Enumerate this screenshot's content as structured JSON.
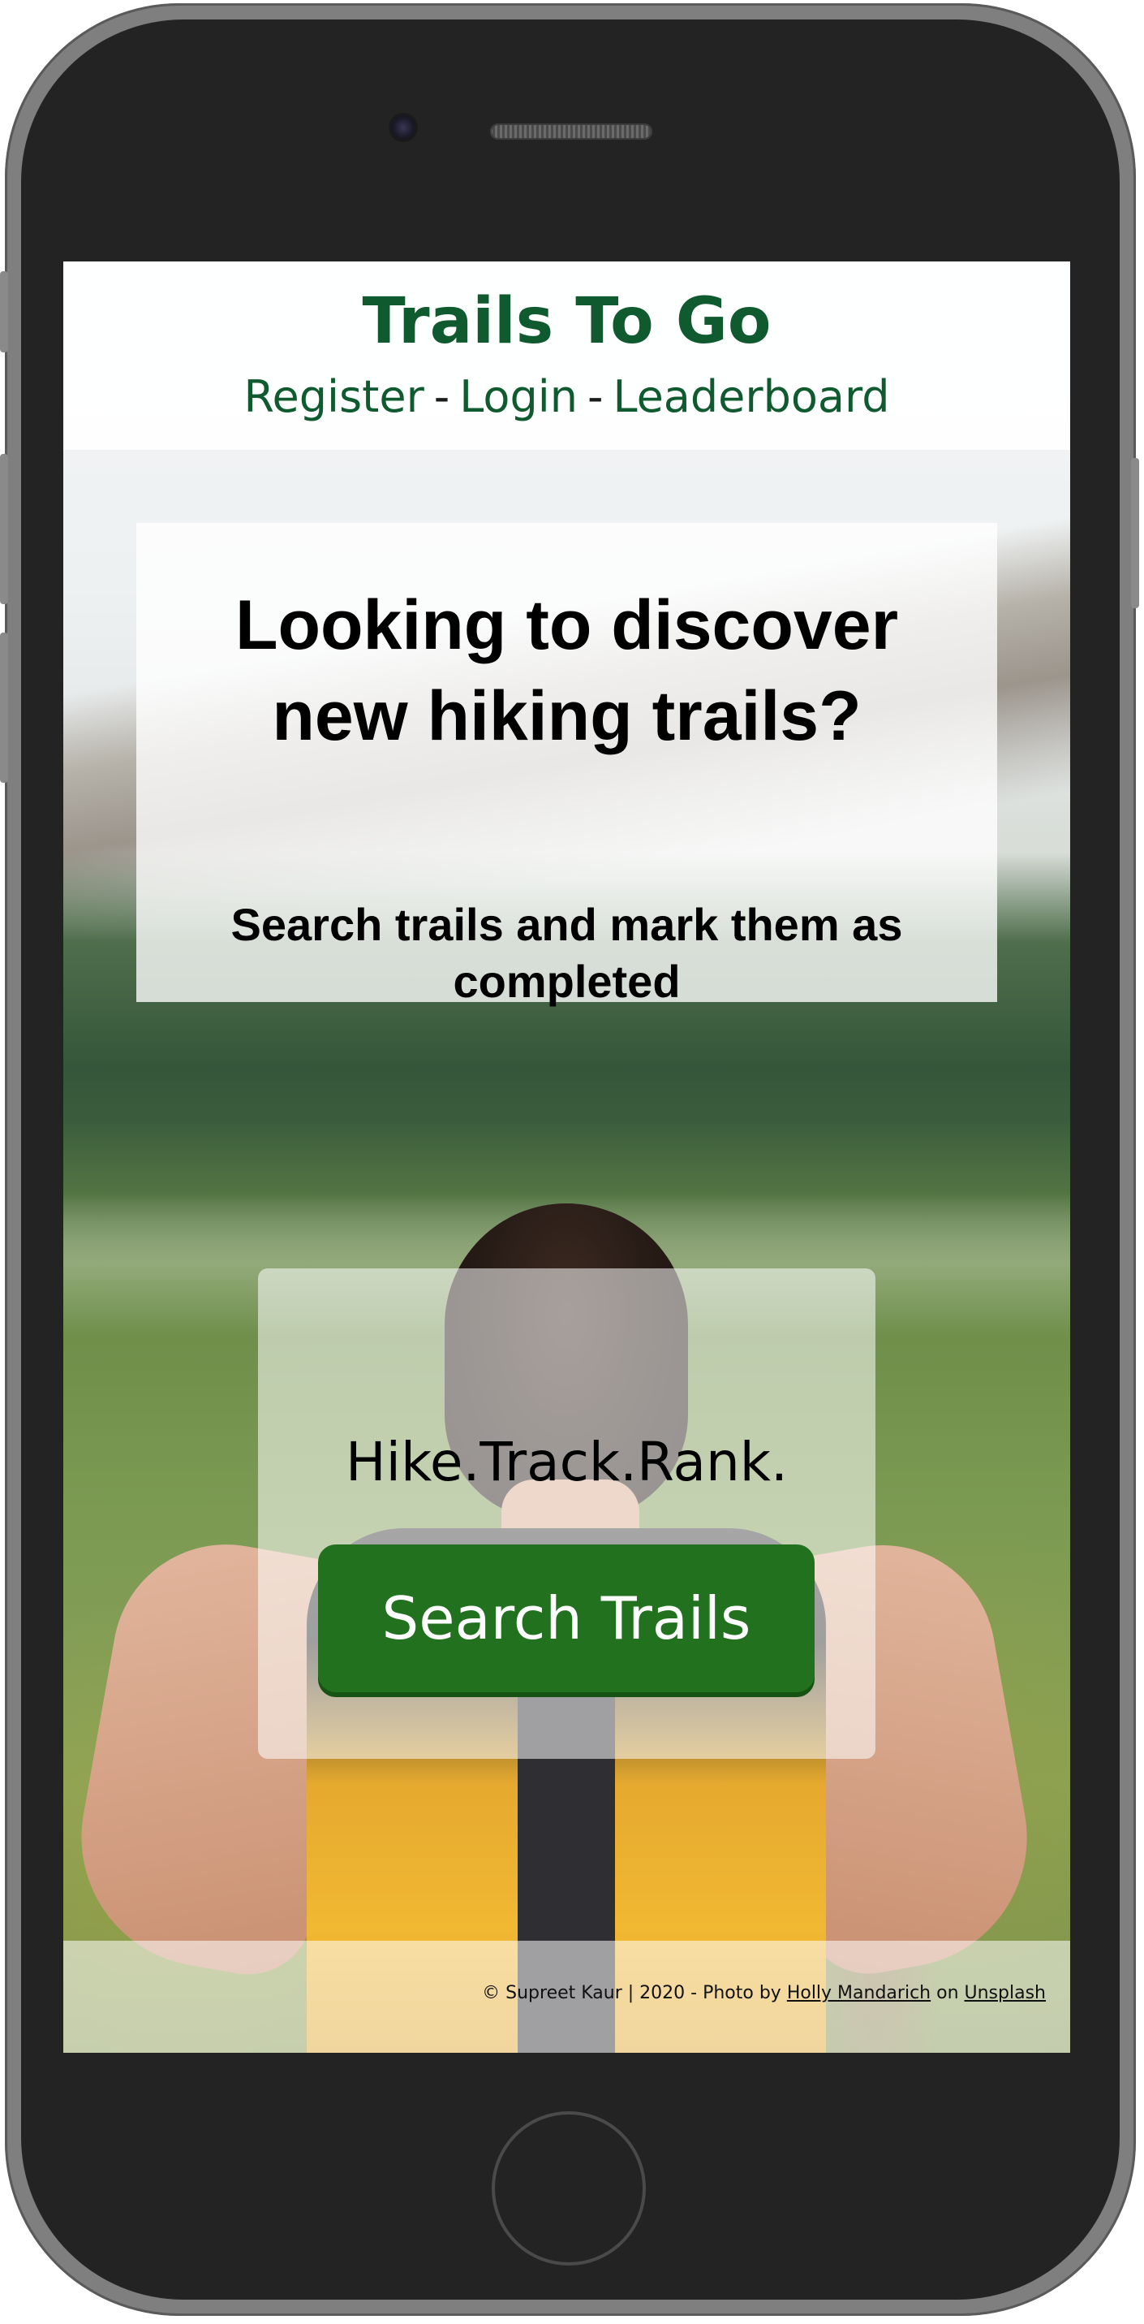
{
  "header": {
    "title": "Trails To Go",
    "nav": {
      "register": "Register",
      "login": "Login",
      "leaderboard": "Leaderboard",
      "separator": "-"
    }
  },
  "hero": {
    "title_line1": "Looking to discover",
    "title_line2": "new hiking trails?",
    "subtitle_line1": "Search trails and mark them as",
    "subtitle_line2": "completed"
  },
  "cta": {
    "tagline": "Hike.Track.Rank.",
    "search_label": "Search Trails"
  },
  "footer": {
    "copyright": "© Supreet Kaur | 2020 - Photo by",
    "photographer": "Holly Mandarich",
    "on": "on",
    "source": "Unsplash"
  },
  "colors": {
    "brand_green": "#0f5a2f",
    "button_green": "#21711f"
  }
}
